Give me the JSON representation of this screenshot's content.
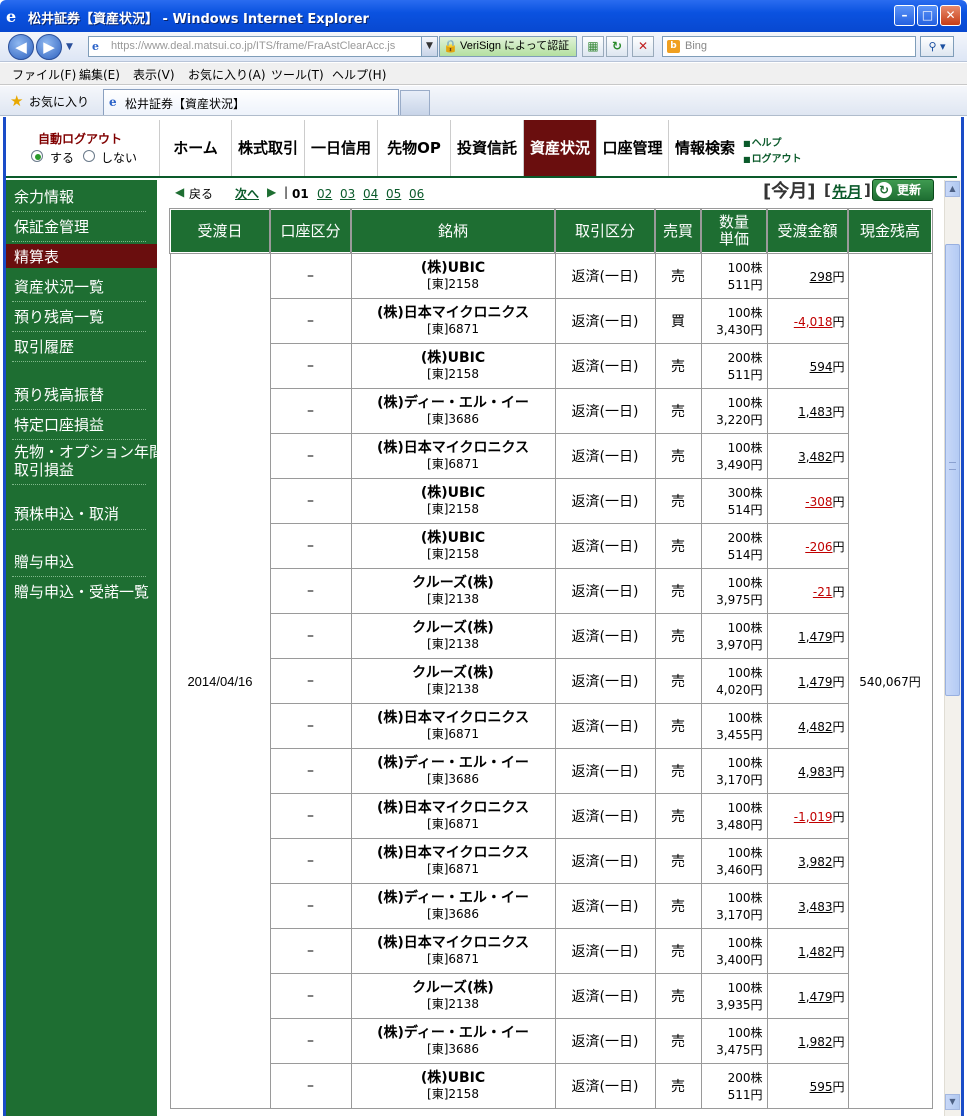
{
  "window": {
    "title": "松井証券【資産状況】 - Windows Internet Explorer",
    "minimize": "–",
    "maximize": "□",
    "close": "✕"
  },
  "address": {
    "url": "https://www.deal.matsui.co.jp/ITS/frame/FraAstClearAcc.js",
    "cert": "VeriSign によって認証",
    "search_placeholder": "Bing"
  },
  "menu": [
    "ファイル(F)",
    "編集(E)",
    "表示(V)",
    "お気に入り(A)",
    "ツール(T)",
    "ヘルプ(H)"
  ],
  "favorites": {
    "label": "お気に入り",
    "tab_title": "松井証券【資産状況】"
  },
  "header": {
    "logout_title": "自動ログアウト",
    "logout_on": "する",
    "logout_off": "しない",
    "tabs": [
      "ホーム",
      "株式取引",
      "一日信用",
      "先物OP",
      "投資信託",
      "資産状況",
      "口座管理",
      "情報検索"
    ],
    "help": "ヘルプ",
    "logout": "ログアウト"
  },
  "sidebar": {
    "items": [
      "余力情報",
      "保証金管理",
      "精算表",
      "資産状況一覧",
      "預り残高一覧",
      "取引履歴",
      "預り残高振替",
      "特定口座損益",
      "先物・オプション年間",
      "取引損益",
      "預株申込・取消",
      "贈与申込",
      "贈与申込・受諾一覧"
    ],
    "active": "精算表"
  },
  "pager": {
    "back": "戻る",
    "next": "次へ",
    "current": "01",
    "pages": [
      "02",
      "03",
      "04",
      "05",
      "06"
    ],
    "this_month": "[今月]",
    "prev_month": "先月",
    "bracket_close": "]",
    "refresh": "更新"
  },
  "table": {
    "headers": [
      "受渡日",
      "口座区分",
      "銘柄",
      "取引区分",
      "売買",
      "数量",
      "単価",
      "受渡金額",
      "現金残高"
    ],
    "date": "2014/04/16",
    "cash_balance": "540,067円",
    "rows": [
      {
        "acct": "–",
        "name": "(株)UBIC",
        "code": "[東]2158",
        "type": "返済(一日)",
        "side": "売",
        "qty": "100株",
        "price": "511円",
        "amount": "298",
        "neg": false
      },
      {
        "acct": "–",
        "name": "(株)日本マイクロニクス",
        "code": "[東]6871",
        "type": "返済(一日)",
        "side": "買",
        "qty": "100株",
        "price": "3,430円",
        "amount": "-4,018",
        "neg": true
      },
      {
        "acct": "–",
        "name": "(株)UBIC",
        "code": "[東]2158",
        "type": "返済(一日)",
        "side": "売",
        "qty": "200株",
        "price": "511円",
        "amount": "594",
        "neg": false
      },
      {
        "acct": "–",
        "name": "(株)ディー・エル・イー",
        "code": "[東]3686",
        "type": "返済(一日)",
        "side": "売",
        "qty": "100株",
        "price": "3,220円",
        "amount": "1,483",
        "neg": false
      },
      {
        "acct": "–",
        "name": "(株)日本マイクロニクス",
        "code": "[東]6871",
        "type": "返済(一日)",
        "side": "売",
        "qty": "100株",
        "price": "3,490円",
        "amount": "3,482",
        "neg": false
      },
      {
        "acct": "–",
        "name": "(株)UBIC",
        "code": "[東]2158",
        "type": "返済(一日)",
        "side": "売",
        "qty": "300株",
        "price": "514円",
        "amount": "-308",
        "neg": true
      },
      {
        "acct": "–",
        "name": "(株)UBIC",
        "code": "[東]2158",
        "type": "返済(一日)",
        "side": "売",
        "qty": "200株",
        "price": "514円",
        "amount": "-206",
        "neg": true
      },
      {
        "acct": "–",
        "name": "クルーズ(株)",
        "code": "[東]2138",
        "type": "返済(一日)",
        "side": "売",
        "qty": "100株",
        "price": "3,975円",
        "amount": "-21",
        "neg": true
      },
      {
        "acct": "–",
        "name": "クルーズ(株)",
        "code": "[東]2138",
        "type": "返済(一日)",
        "side": "売",
        "qty": "100株",
        "price": "3,970円",
        "amount": "1,479",
        "neg": false
      },
      {
        "acct": "–",
        "name": "クルーズ(株)",
        "code": "[東]2138",
        "type": "返済(一日)",
        "side": "売",
        "qty": "100株",
        "price": "4,020円",
        "amount": "1,479",
        "neg": false
      },
      {
        "acct": "–",
        "name": "(株)日本マイクロニクス",
        "code": "[東]6871",
        "type": "返済(一日)",
        "side": "売",
        "qty": "100株",
        "price": "3,455円",
        "amount": "4,482",
        "neg": false
      },
      {
        "acct": "–",
        "name": "(株)ディー・エル・イー",
        "code": "[東]3686",
        "type": "返済(一日)",
        "side": "売",
        "qty": "100株",
        "price": "3,170円",
        "amount": "4,983",
        "neg": false
      },
      {
        "acct": "–",
        "name": "(株)日本マイクロニクス",
        "code": "[東]6871",
        "type": "返済(一日)",
        "side": "売",
        "qty": "100株",
        "price": "3,480円",
        "amount": "-1,019",
        "neg": true
      },
      {
        "acct": "–",
        "name": "(株)日本マイクロニクス",
        "code": "[東]6871",
        "type": "返済(一日)",
        "side": "売",
        "qty": "100株",
        "price": "3,460円",
        "amount": "3,982",
        "neg": false
      },
      {
        "acct": "–",
        "name": "(株)ディー・エル・イー",
        "code": "[東]3686",
        "type": "返済(一日)",
        "side": "売",
        "qty": "100株",
        "price": "3,170円",
        "amount": "3,483",
        "neg": false
      },
      {
        "acct": "–",
        "name": "(株)日本マイクロニクス",
        "code": "[東]6871",
        "type": "返済(一日)",
        "side": "売",
        "qty": "100株",
        "price": "3,400円",
        "amount": "1,482",
        "neg": false
      },
      {
        "acct": "–",
        "name": "クルーズ(株)",
        "code": "[東]2138",
        "type": "返済(一日)",
        "side": "売",
        "qty": "100株",
        "price": "3,935円",
        "amount": "1,479",
        "neg": false
      },
      {
        "acct": "–",
        "name": "(株)ディー・エル・イー",
        "code": "[東]3686",
        "type": "返済(一日)",
        "side": "売",
        "qty": "100株",
        "price": "3,475円",
        "amount": "1,982",
        "neg": false
      },
      {
        "acct": "–",
        "name": "(株)UBIC",
        "code": "[東]2158",
        "type": "返済(一日)",
        "side": "売",
        "qty": "200株",
        "price": "511円",
        "amount": "595",
        "neg": false
      }
    ],
    "yen": "円"
  }
}
